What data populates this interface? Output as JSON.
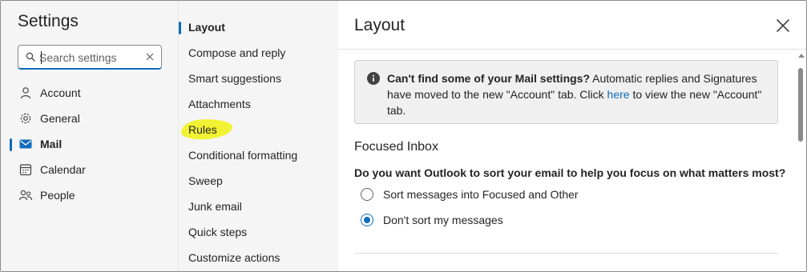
{
  "app": {
    "title": "Settings",
    "search": {
      "placeholder": "Search settings",
      "value": ""
    }
  },
  "nav": {
    "items": [
      {
        "label": "Account",
        "icon": "person-icon",
        "active": false
      },
      {
        "label": "General",
        "icon": "gear-icon",
        "active": false
      },
      {
        "label": "Mail",
        "icon": "mail-icon",
        "active": true
      },
      {
        "label": "Calendar",
        "icon": "calendar-icon",
        "active": false
      },
      {
        "label": "People",
        "icon": "people-icon",
        "active": false
      }
    ]
  },
  "subnav": {
    "items": [
      {
        "label": "Layout",
        "active": true
      },
      {
        "label": "Compose and reply",
        "active": false
      },
      {
        "label": "Smart suggestions",
        "active": false
      },
      {
        "label": "Attachments",
        "active": false
      },
      {
        "label": "Rules",
        "active": false,
        "highlighted": true
      },
      {
        "label": "Conditional formatting",
        "active": false
      },
      {
        "label": "Sweep",
        "active": false
      },
      {
        "label": "Junk email",
        "active": false
      },
      {
        "label": "Quick steps",
        "active": false
      },
      {
        "label": "Customize actions",
        "active": false
      }
    ]
  },
  "pane": {
    "title": "Layout",
    "info": {
      "bold": "Can't find some of your Mail settings?",
      "text_before_link": " Automatic replies and Signatures have moved to the new \"Account\" tab. Click ",
      "link": "here",
      "text_after_link": " to view the new \"Account\" tab."
    },
    "focused_inbox": {
      "title": "Focused Inbox",
      "question": "Do you want Outlook to sort your email to help you focus on what matters most?",
      "options": [
        {
          "label": "Sort messages into Focused and Other",
          "checked": false
        },
        {
          "label": "Don't sort my messages",
          "checked": true
        }
      ]
    }
  },
  "colors": {
    "accent": "#0f6cbd",
    "highlight": "#f2f234",
    "nav_background": "#f5f5f5"
  }
}
